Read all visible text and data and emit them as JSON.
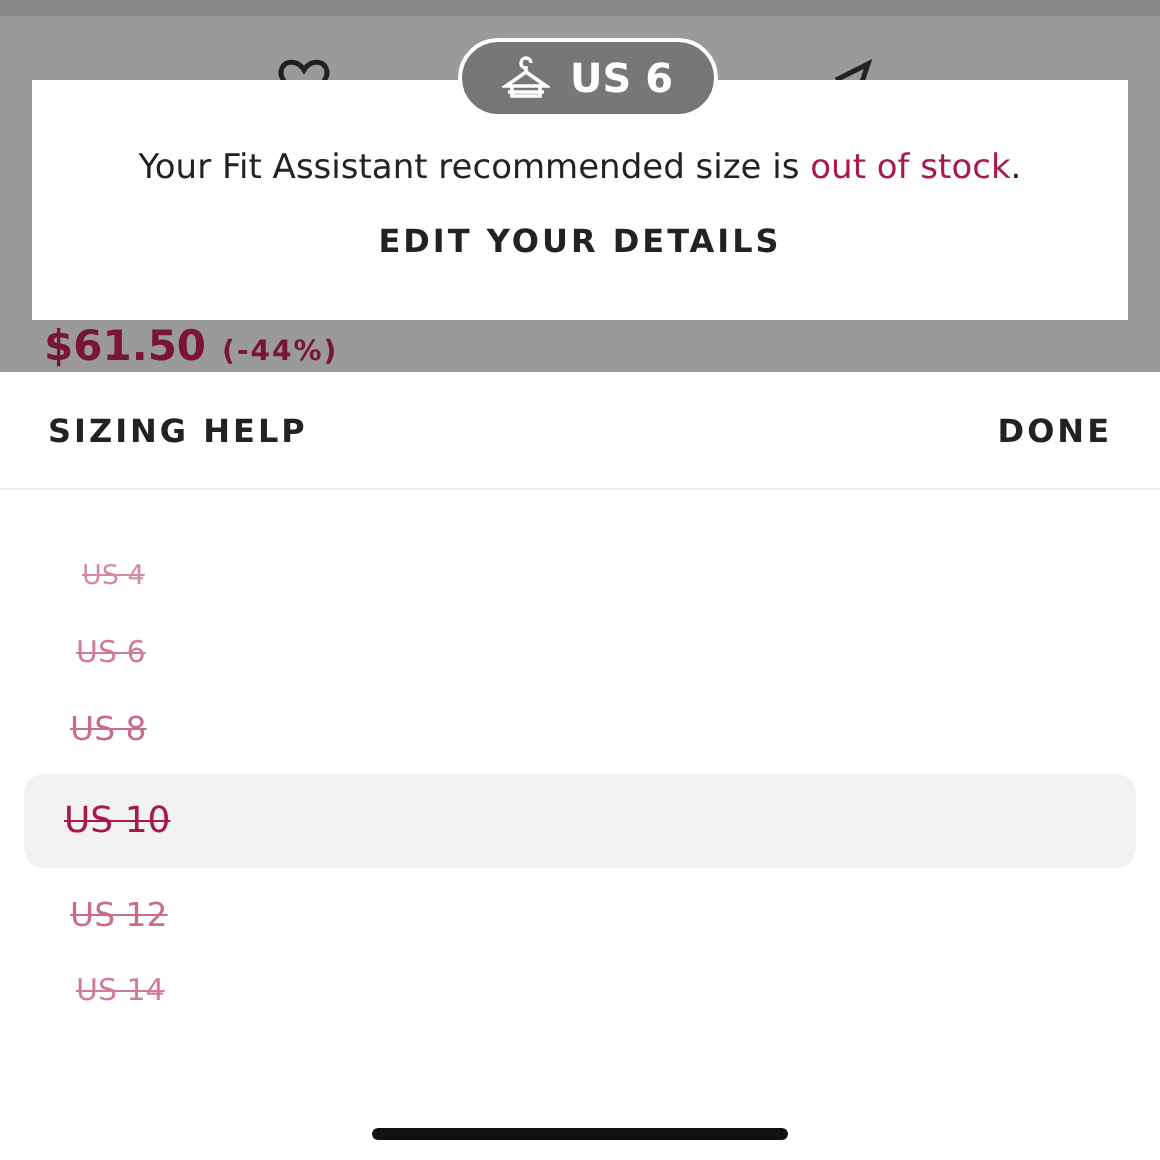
{
  "background_page": {
    "price": "$61.50",
    "discount": "(-44%)"
  },
  "fit_popup": {
    "badge": "US 6",
    "message": "Your Fit Assistant recommended size is **out of stock**.",
    "action": "EDIT YOUR DETAILS"
  },
  "sheet": {
    "left_action": "SIZING HELP",
    "right_action": "DONE"
  },
  "sizes": [
    {
      "label": "US 4",
      "out_of_stock": true,
      "selected": false
    },
    {
      "label": "US 6",
      "out_of_stock": true,
      "selected": false
    },
    {
      "label": "US 8",
      "out_of_stock": true,
      "selected": false
    },
    {
      "label": "US 10",
      "out_of_stock": true,
      "selected": true
    },
    {
      "label": "US 12",
      "out_of_stock": true,
      "selected": false
    },
    {
      "label": "US 14",
      "out_of_stock": true,
      "selected": false
    }
  ]
}
